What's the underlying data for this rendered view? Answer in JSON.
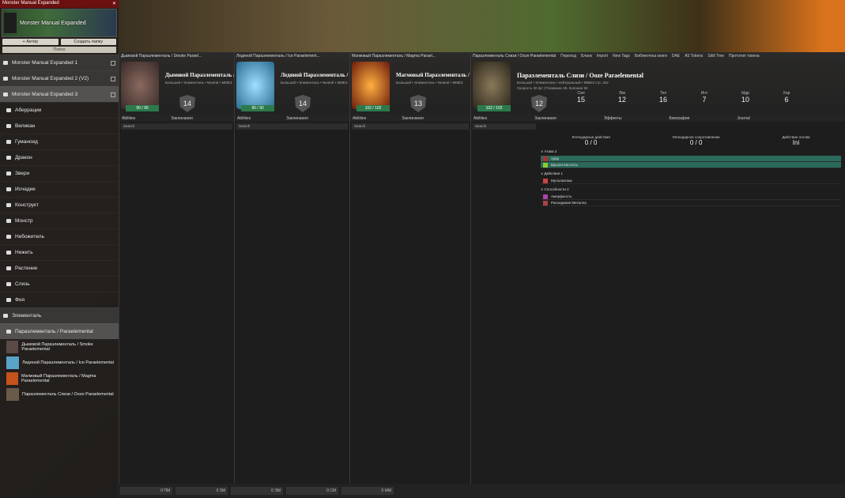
{
  "sidebar": {
    "title": "Monster Manual Expanded",
    "banner": "Monster Manual Expanded",
    "btn_actor": "+ Актёр",
    "btn_folder": "Создать папку",
    "search": "Поиск",
    "compendia": [
      "Monster Manual Expanded 1",
      "Monster Manual Expanded 2 (V2)",
      "Monster Manual Expanded 3"
    ],
    "folders": [
      "Аберрации",
      "Великан",
      "Гуманоид",
      "Дракон",
      "Звери",
      "Исчадие",
      "Конструкт",
      "Монстр",
      "Небожитель",
      "Нежить",
      "Растение",
      "Слизь",
      "Фея",
      "Элементаль"
    ],
    "subfolder": "Параэлементаль / Paraelemental",
    "entries": [
      "Дымовой Параэлементаль / Smoke Paraelemental",
      "Ледяной Параэлементаль / Ice Paraelemental",
      "Магмовый Параэлементаль / Magma Paraelemental",
      "Параэлементаль Слизи / Ooze Paraelemental"
    ]
  },
  "sheets": [
    {
      "header": "Дымовой Параэлементаль / Smoke Parael...",
      "name": "Дымовой Параэлементаль / Smoke Paraele",
      "meta": "Большой • Элементаль • Neutral • MME3",
      "hp": "90 / 90",
      "ac": "14",
      "color": "#6a4a44"
    },
    {
      "header": "Ледяной Параэлементаль / Ice Paraelement...",
      "name": "Ледяной Параэлементаль / I",
      "meta": "Большой • Элементаль • Neutral • MME3",
      "hp": "90 / 90",
      "ac": "14",
      "color": "#5aa3c8"
    },
    {
      "header": "Магмовый Параэлементаль / Magma Parael...",
      "name": "Магмовый Параэлементаль / M",
      "meta": "Большой • Элементаль • Neutral • MME3",
      "hp": "102 / 102",
      "ac": "13",
      "color": "#c4521a"
    }
  ],
  "active": {
    "header": "Параэлементаль Слизи / Ooze Paraelemental",
    "name": "Параэлементаль Слизи / Ooze Paraelemental",
    "meta": "Большой • Элементаль • нейтральный • MME3 стр. 202",
    "hp": "102 / 102",
    "ac": "12",
    "speed": "Скорость 30 фт | Плавание 29, Копание 50",
    "toolbar": [
      "Переход",
      "Бланк",
      "Import",
      "New Tags",
      "Библиотека книги",
      "DAE",
      "A5 Tokens",
      "Skill Tree",
      "Прототип токена"
    ],
    "stats": [
      {
        "k": "Сил",
        "v": "15"
      },
      {
        "k": "Лвк",
        "v": "12"
      },
      {
        "k": "Тел",
        "v": "16"
      },
      {
        "k": "Инт",
        "v": "7"
      },
      {
        "k": "Мдр",
        "v": "10"
      },
      {
        "k": "Хар",
        "v": "6"
      }
    ],
    "tabs": [
      "Abilities",
      "Заклинания",
      "Эффекты",
      "Биография",
      "Journal"
    ],
    "legend": "Легендарные действия",
    "legendv": "0 / 0",
    "resist": "Легендарное сопротивление",
    "resistv": "0 / 0",
    "lair": "Действие логова",
    "lairv": "Ini",
    "actions": [
      "Удар",
      "Брызги Кислоты"
    ],
    "bonus": [
      "Мультиатака"
    ],
    "abilities": [
      "Аморфность",
      "Разъедание Металла"
    ]
  },
  "footer": [
    "0 ПМ",
    "0 ЗМ",
    "0 ЭМ",
    "0 СМ",
    "0 ММ"
  ]
}
